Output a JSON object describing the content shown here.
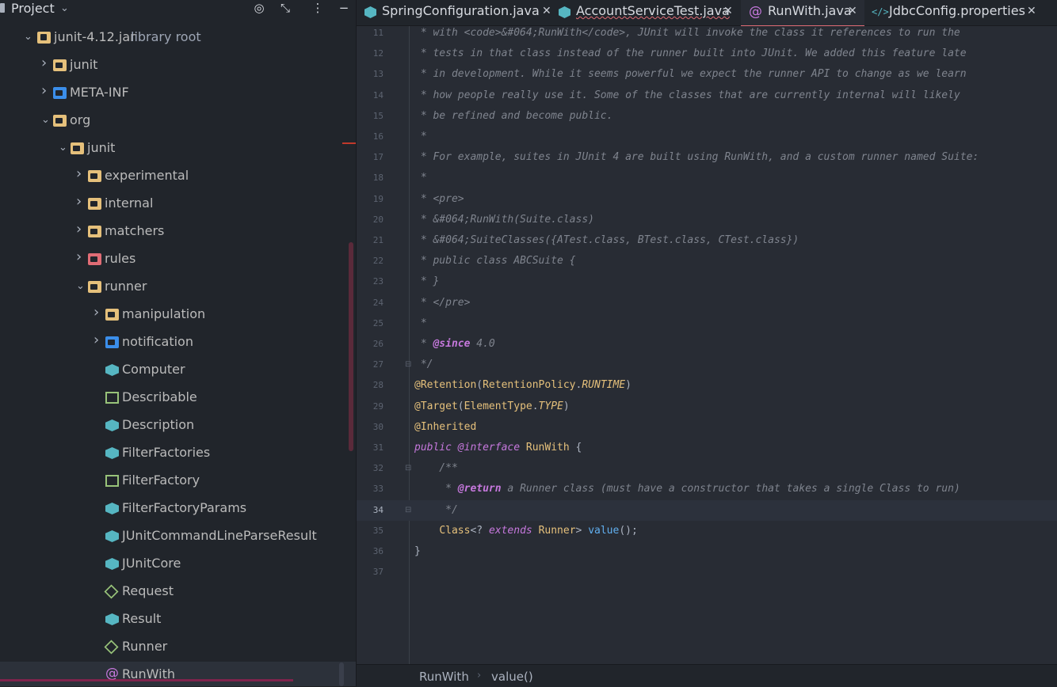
{
  "sidebar": {
    "title": "Project",
    "root": "junit-4.12.jar",
    "root_suffix": "library root",
    "items": [
      {
        "label": "junit-4.12.jar",
        "icon": "jar-icon",
        "expanded": true
      },
      {
        "label": "junit",
        "icon": "package-icon",
        "expanded": false
      },
      {
        "label": "META-INF",
        "icon": "folder-icon",
        "expanded": false
      },
      {
        "label": "org",
        "icon": "package-icon",
        "expanded": true
      },
      {
        "label": "junit",
        "icon": "package-icon",
        "expanded": true
      },
      {
        "label": "experimental",
        "icon": "package-icon",
        "expanded": false
      },
      {
        "label": "internal",
        "icon": "package-icon",
        "expanded": false
      },
      {
        "label": "matchers",
        "icon": "package-icon",
        "expanded": false
      },
      {
        "label": "rules",
        "icon": "package-icon",
        "expanded": false
      },
      {
        "label": "runner",
        "icon": "package-icon",
        "expanded": true
      },
      {
        "label": "manipulation",
        "icon": "package-icon",
        "expanded": false
      },
      {
        "label": "notification",
        "icon": "package-icon",
        "expanded": false
      },
      {
        "label": "Computer",
        "icon": "class-icon"
      },
      {
        "label": "Describable",
        "icon": "interface-icon"
      },
      {
        "label": "Description",
        "icon": "class-icon"
      },
      {
        "label": "FilterFactories",
        "icon": "class-icon"
      },
      {
        "label": "FilterFactory",
        "icon": "interface-icon"
      },
      {
        "label": "FilterFactoryParams",
        "icon": "class-icon"
      },
      {
        "label": "JUnitCommandLineParseResult",
        "icon": "class-icon"
      },
      {
        "label": "JUnitCore",
        "icon": "class-icon"
      },
      {
        "label": "Request",
        "icon": "abstract-class-icon"
      },
      {
        "label": "Result",
        "icon": "class-icon"
      },
      {
        "label": "Runner",
        "icon": "abstract-class-icon"
      },
      {
        "label": "RunWith",
        "icon": "annotation-icon"
      }
    ]
  },
  "tabs": [
    {
      "label": "SpringConfiguration.java",
      "icon": "class-icon",
      "active": false
    },
    {
      "label": "AccountServiceTest.java",
      "icon": "class-icon",
      "active": false
    },
    {
      "label": "RunWith.java",
      "icon": "annotation-icon",
      "active": true
    },
    {
      "label": "JdbcConfig.properties",
      "icon": "properties-icon",
      "active": false
    }
  ],
  "editor": {
    "current_line": 34,
    "lines": [
      {
        "n": "11",
        "text": " * with <code>&#064;RunWith</code>, JUnit will invoke the class it references to run the"
      },
      {
        "n": "12",
        "text": " * tests in that class instead of the runner built into JUnit. We added this feature late"
      },
      {
        "n": "13",
        "text": " * in development. While it seems powerful we expect the runner API to change as we learn"
      },
      {
        "n": "14",
        "text": " * how people really use it. Some of the classes that are currently internal will likely"
      },
      {
        "n": "15",
        "text": " * be refined and become public."
      },
      {
        "n": "16",
        "text": " *"
      },
      {
        "n": "17",
        "text": " * For example, suites in JUnit 4 are built using RunWith, and a custom runner named Suite:"
      },
      {
        "n": "18",
        "text": " *"
      },
      {
        "n": "19",
        "text": " * <pre>"
      },
      {
        "n": "20",
        "text": " * &#064;RunWith(Suite.class)"
      },
      {
        "n": "21",
        "text": " * &#064;SuiteClasses({ATest.class, BTest.class, CTest.class})"
      },
      {
        "n": "22",
        "text": " * public class ABCSuite {"
      },
      {
        "n": "23",
        "text": " * }"
      },
      {
        "n": "24",
        "text": " * </pre>"
      },
      {
        "n": "25",
        "text": " *"
      },
      {
        "n": "26",
        "text": " * @since 4.0"
      },
      {
        "n": "27",
        "text": " */"
      },
      {
        "n": "28",
        "text": "@Retention(RetentionPolicy.RUNTIME)"
      },
      {
        "n": "29",
        "text": "@Target(ElementType.TYPE)"
      },
      {
        "n": "30",
        "text": "@Inherited"
      },
      {
        "n": "31",
        "text": "public @interface RunWith {"
      },
      {
        "n": "32",
        "text": "    /**"
      },
      {
        "n": "33",
        "text": "     * @return a Runner class (must have a constructor that takes a single Class to run)"
      },
      {
        "n": "34",
        "text": "     */"
      },
      {
        "n": "35",
        "text": "    Class<? extends Runner> value();"
      },
      {
        "n": "36",
        "text": "}"
      },
      {
        "n": "37",
        "text": ""
      }
    ]
  },
  "breadcrumb": {
    "items": [
      "RunWith",
      "value()"
    ]
  },
  "colors": {
    "accent": "#e06c75",
    "annotation": "#e5c07b",
    "keyword": "#c678dd",
    "method": "#61afef",
    "comment": "#7f848e"
  }
}
